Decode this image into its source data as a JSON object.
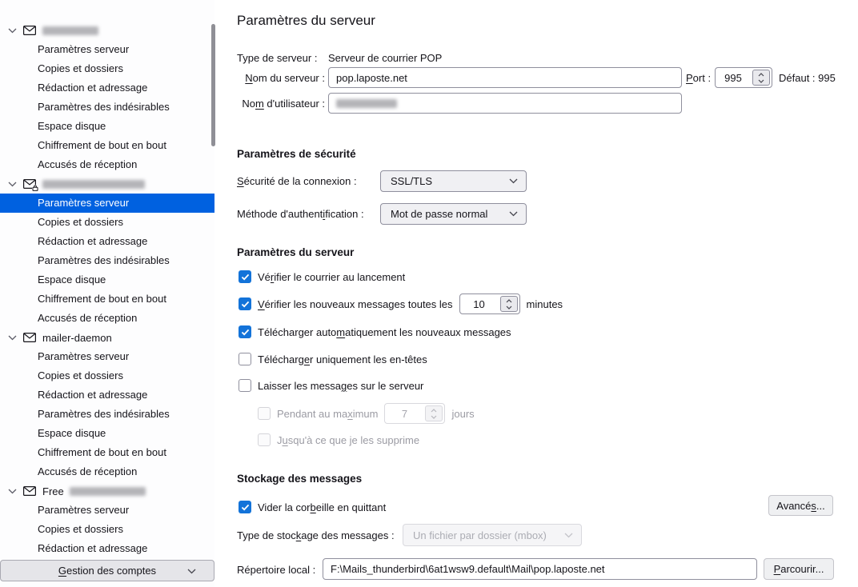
{
  "colors": {
    "accent_selection": "#0061e0",
    "checkbox_blue": "#1373d9",
    "text": "#15141a"
  },
  "sidebar": {
    "menu_items": [
      "Paramètres serveur",
      "Copies et dossiers",
      "Rédaction et adressage",
      "Paramètres des indésirables",
      "Espace disque",
      "Chiffrement de bout en bout",
      "Accusés de réception"
    ],
    "accounts": [
      {
        "name": "",
        "redacted": true
      },
      {
        "name": "",
        "redacted": true
      },
      {
        "name": "mailer-daemon",
        "redacted": false
      },
      {
        "name": "Free",
        "redacted": true
      }
    ],
    "selected_item": "Paramètres serveur",
    "manage_button": "[G]estion des comptes",
    "icons": [
      "chevron-down-icon",
      "mail-account-icon",
      "mail-account-lock-icon"
    ]
  },
  "main": {
    "title": "Paramètres du serveur",
    "server_type": {
      "label": "Type de serveur :",
      "value": "Serveur de courrier POP"
    },
    "server_name": {
      "label": "[N]om du serveur :",
      "value": "pop.laposte.net"
    },
    "port": {
      "label": "[P]ort :",
      "value": "995",
      "default_text": "Défaut : 995"
    },
    "username": {
      "label": "No[m] d'utilisateur :",
      "value": "",
      "redacted": true
    },
    "security_section": {
      "heading": "Paramètres de sécurité",
      "connection_security": {
        "label": "[S]écurité de la connexion :",
        "value": "SSL/TLS"
      },
      "auth_method": {
        "label": "Méthode d'authent[i]fication :",
        "value": "Mot de passe normal"
      }
    },
    "server_section": {
      "heading": "Paramètres du serveur",
      "check_on_startup": {
        "label": "Vé[r]ifier le courrier au lancement",
        "checked": true
      },
      "check_every": {
        "before": "[V]érifier les nouveaux messages toutes les",
        "value": "10",
        "after": "minutes",
        "checked": true
      },
      "auto_download": {
        "label": "Télécharger auto[m]atiquement les nouveaux messages",
        "checked": true
      },
      "headers_only": {
        "label": "Télécharg[e]r uniquement les en-têtes",
        "checked": false
      },
      "leave_on_server": {
        "label": "Laisser les messa[g]es sur le serveur",
        "checked": false
      },
      "max_days": {
        "before": "Pendant au ma[x]imum",
        "value": "7",
        "after": "jours",
        "checked": false,
        "disabled": true
      },
      "until_deleted": {
        "label": "J[u]squ'à ce que je les supprime",
        "checked": false,
        "disabled": true
      }
    },
    "storage_section": {
      "heading": "Stockage des messages",
      "empty_trash": {
        "label": "Vider la cor[b]eille en quittant",
        "checked": true
      },
      "advanced_button": "Avancé[s]...",
      "storage_type": {
        "label": "Type de stoc[k]age des messages :",
        "value": "Un fichier par dossier (mbox)",
        "disabled": true
      },
      "local_directory": {
        "label": "Répertoire local :",
        "value": "F:\\Mails_thunderbird\\6at1wsw9.default\\Mail\\pop.laposte.net"
      },
      "browse_button": "[P]arcourir..."
    }
  }
}
